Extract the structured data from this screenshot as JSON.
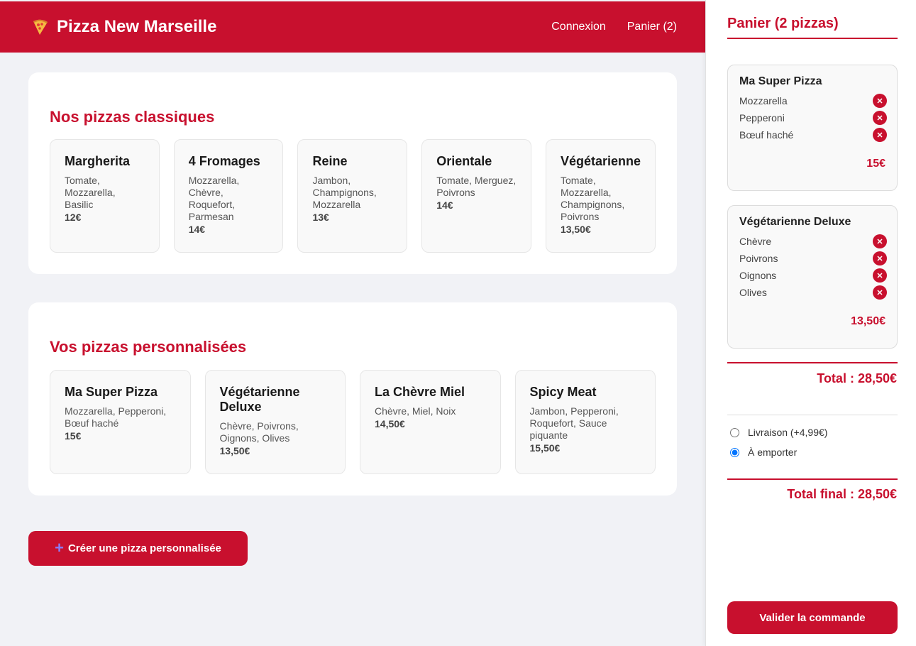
{
  "header": {
    "brand": "Pizza New Marseille",
    "nav": {
      "login": "Connexion",
      "cart": "Panier (2)"
    }
  },
  "classic": {
    "title": "Nos pizzas classiques",
    "pizzas": [
      {
        "name": "Margherita",
        "ingredients": "Tomate, Mozzarella, Basilic",
        "price": "12€"
      },
      {
        "name": "4 Fromages",
        "ingredients": "Mozzarella, Chèvre, Roquefort, Parmesan",
        "price": "14€"
      },
      {
        "name": "Reine",
        "ingredients": "Jambon, Champignons, Mozzarella",
        "price": "13€"
      },
      {
        "name": "Orientale",
        "ingredients": "Tomate, Merguez, Poivrons",
        "price": "14€"
      },
      {
        "name": "Végétarienne",
        "ingredients": "Tomate, Mozzarella, Champignons, Poivrons",
        "price": "13,50€"
      }
    ]
  },
  "custom": {
    "title": "Vos pizzas personnalisées",
    "pizzas": [
      {
        "name": "Ma Super Pizza",
        "ingredients": "Mozzarella, Pepperoni, Bœuf haché",
        "price": "15€"
      },
      {
        "name": "Végétarienne Deluxe",
        "ingredients": "Chèvre, Poivrons, Oignons, Olives",
        "price": "13,50€"
      },
      {
        "name": "La Chèvre Miel",
        "ingredients": "Chèvre, Miel, Noix",
        "price": "14,50€"
      },
      {
        "name": "Spicy Meat",
        "ingredients": "Jambon, Pepperoni, Roquefort, Sauce piquante",
        "price": "15,50€"
      }
    ]
  },
  "create_button": {
    "icon": "plus-icon",
    "label": "Créer une pizza personnalisée"
  },
  "cart": {
    "title": "Panier (2 pizzas)",
    "items": [
      {
        "name": "Ma Super Pizza",
        "ingredients": [
          "Mozzarella",
          "Pepperoni",
          "Bœuf haché"
        ],
        "price": "15€"
      },
      {
        "name": "Végétarienne Deluxe",
        "ingredients": [
          "Chèvre",
          "Poivrons",
          "Oignons",
          "Olives"
        ],
        "price": "13,50€"
      }
    ],
    "remove_symbol": "✕",
    "total": "Total : 28,50€",
    "options": [
      {
        "label": "Livraison (+4,99€)",
        "checked": false
      },
      {
        "label": "À emporter",
        "checked": true
      }
    ],
    "final_total": "Total final : 28,50€",
    "validate_label": "Valider la commande"
  },
  "colors": {
    "primary": "#c8102e",
    "background": "#f1f2f6",
    "card": "#f9f9f9",
    "accent_plus": "#8b7cf6"
  }
}
